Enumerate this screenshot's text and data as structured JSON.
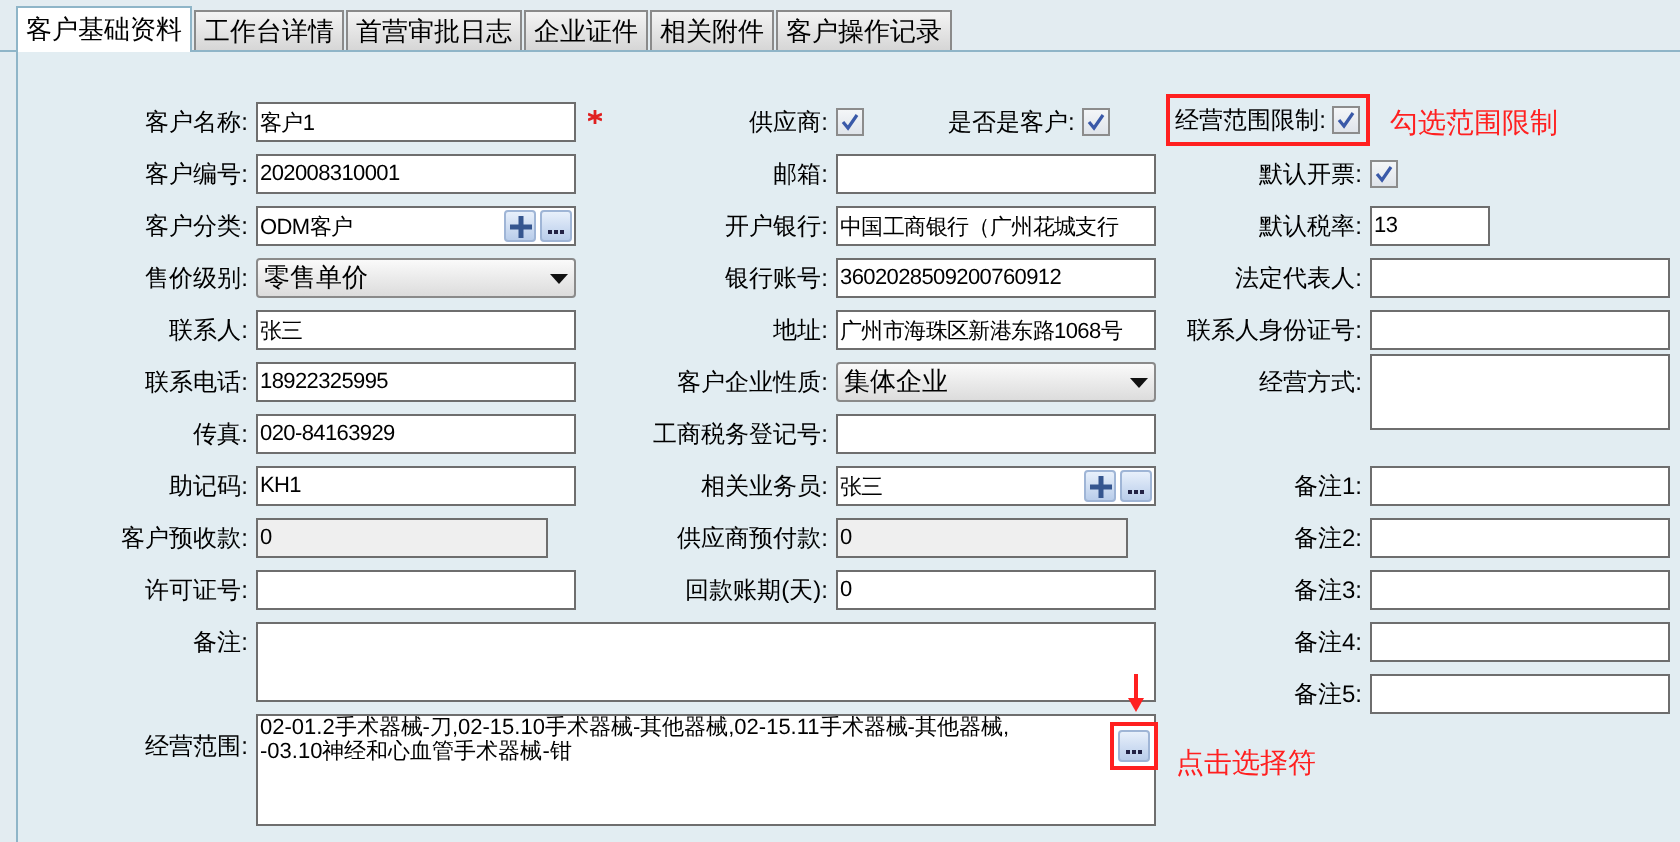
{
  "tabs": [
    {
      "label": "客户基础资料",
      "selected": true
    },
    {
      "label": "工作台详情",
      "selected": false
    },
    {
      "label": "首营审批日志",
      "selected": false
    },
    {
      "label": "企业证件",
      "selected": false
    },
    {
      "label": "相关附件",
      "selected": false
    },
    {
      "label": "客户操作记录",
      "selected": false
    }
  ],
  "left_column": [
    {
      "kind": "text",
      "label": "客户名称:",
      "value": "客户1",
      "required": true
    },
    {
      "kind": "text",
      "label": "客户编号:",
      "value": "202008310001"
    },
    {
      "kind": "lookup",
      "label": "客户分类:",
      "value": "ODM客户"
    },
    {
      "kind": "select",
      "label": "售价级别:",
      "value": "零售单价"
    },
    {
      "kind": "text",
      "label": "联系人:",
      "value": "张三"
    },
    {
      "kind": "text",
      "label": "联系电话:",
      "value": "18922325995"
    },
    {
      "kind": "text",
      "label": "传真:",
      "value": "020-84163929"
    },
    {
      "kind": "text",
      "label": "助记码:",
      "value": "KH1"
    },
    {
      "kind": "readonly",
      "label": "客户预收款:",
      "value": "0"
    },
    {
      "kind": "text",
      "label": "许可证号:"
    },
    {
      "kind": "wide_textarea",
      "label": "备注:"
    },
    {
      "kind": "wide_textarea",
      "label": "经营范围:",
      "lines": [
        "02-01.2手术器械-刀,02-15.10手术器械-其他器械,02-15.11手术器械-其他器械,",
        "-03.10神经和心血管手术器械-钳"
      ],
      "picker": {
        "highlighted": true,
        "annotation": "点击选择符"
      }
    }
  ],
  "middle_column": [
    {
      "kind": "check",
      "label": "供应商:",
      "checked": true,
      "extra": {
        "label": "是否是客户:",
        "checked": true
      }
    },
    {
      "kind": "text",
      "label": "邮箱:"
    },
    {
      "kind": "text",
      "label": "开户银行:",
      "value": "中国工商银行（广州花城支行"
    },
    {
      "kind": "text",
      "label": "银行账号:",
      "value": "3602028509200760912"
    },
    {
      "kind": "text",
      "label": "地址:",
      "value": "广州市海珠区新港东路1068号"
    },
    {
      "kind": "select",
      "label": "客户企业性质:",
      "value": "集体企业"
    },
    {
      "kind": "text",
      "label": "工商税务登记号:"
    },
    {
      "kind": "lookup",
      "label": "相关业务员:",
      "value": "张三"
    },
    {
      "kind": "readonly",
      "label": "供应商预付款:",
      "value": "0"
    },
    {
      "kind": "text",
      "label": "回款账期(天):",
      "value": "0"
    }
  ],
  "right_column": [
    {
      "kind": "check",
      "label": "经营范围限制:",
      "checked": true,
      "highlighted": true,
      "annotation": "勾选范围限制"
    },
    {
      "kind": "check",
      "label": "默认开票:",
      "checked": true
    },
    {
      "kind": "short_text",
      "label": "默认税率:",
      "value": "13"
    },
    {
      "kind": "text",
      "label": "法定代表人:"
    },
    {
      "kind": "text",
      "label": "联系人身份证号:"
    },
    {
      "kind": "textarea",
      "label": "经营方式:"
    },
    {
      "kind": "text",
      "label": "备注1:"
    },
    {
      "kind": "text",
      "label": "备注2:"
    },
    {
      "kind": "text",
      "label": "备注3:"
    },
    {
      "kind": "text",
      "label": "备注4:"
    },
    {
      "kind": "text",
      "label": "备注5:"
    }
  ]
}
